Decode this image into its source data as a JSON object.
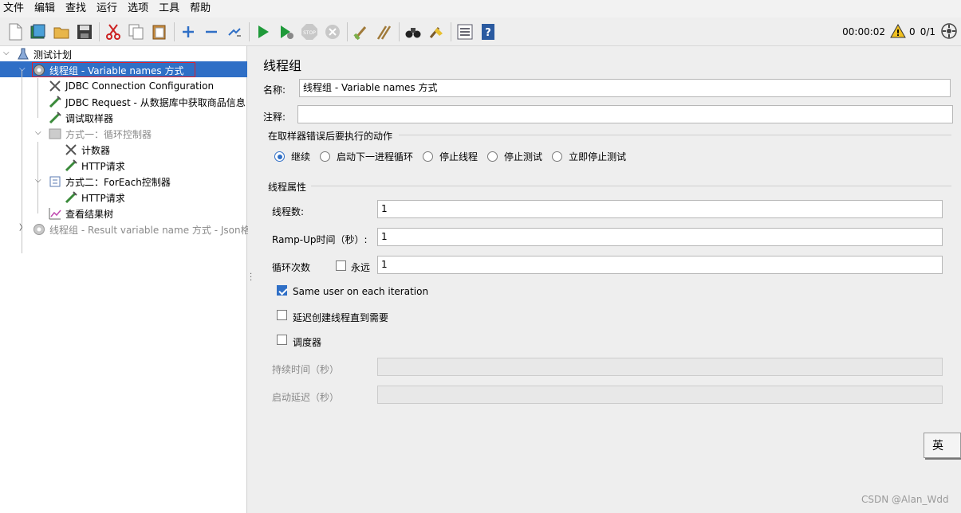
{
  "menu": [
    "文件",
    "编辑",
    "查找",
    "运行",
    "选项",
    "工具",
    "帮助"
  ],
  "toolbar": {
    "icons": [
      "new-icon",
      "templates-icon",
      "open-icon",
      "save-icon",
      "cut-icon",
      "copy-icon",
      "paste-icon",
      "expand-icon",
      "collapse-icon",
      "toggle-icon",
      "start-icon",
      "start-no-pause-icon",
      "stop-icon",
      "shutdown-icon",
      "clear-icon",
      "clear-all-icon",
      "search-icon",
      "reset-search-icon",
      "function-helper-icon",
      "help-icon"
    ],
    "timer": "00:00:02",
    "warnings": "0",
    "threads": "0/1"
  },
  "tree": {
    "items": [
      {
        "label": "测试计划",
        "icon": "test-plan-icon"
      },
      {
        "label": "线程组 - Variable names 方式",
        "icon": "thread-group-icon"
      },
      {
        "label": "JDBC Connection Configuration",
        "icon": "config-element-icon"
      },
      {
        "label": "JDBC Request - 从数据库中获取商品信息",
        "icon": "sampler-icon"
      },
      {
        "label": "调试取样器",
        "icon": "sampler-icon"
      },
      {
        "label": "方式一：循环控制器",
        "icon": "loop-controller-icon"
      },
      {
        "label": "计数器",
        "icon": "config-element-icon"
      },
      {
        "label": "HTTP请求",
        "icon": "sampler-icon"
      },
      {
        "label": "方式二：ForEach控制器",
        "icon": "foreach-controller-icon"
      },
      {
        "label": "HTTP请求",
        "icon": "sampler-icon"
      },
      {
        "label": "查看结果树",
        "icon": "listener-icon"
      },
      {
        "label": "线程组 - Result variable name 方式 - Json格式",
        "icon": "thread-group-icon"
      }
    ]
  },
  "panel": {
    "title": "线程组",
    "name_label": "名称:",
    "name_value": "线程组 - Variable names 方式",
    "comment_label": "注释:",
    "comment_value": "",
    "error_section": "在取样器错误后要执行的动作",
    "error_options": [
      "继续",
      "启动下一进程循环",
      "停止线程",
      "停止测试",
      "立即停止测试"
    ],
    "thread_section": "线程属性",
    "threads_label": "线程数:",
    "threads_value": "1",
    "rampup_label": "Ramp-Up时间（秒）:",
    "rampup_value": "1",
    "loop_label": "循环次数",
    "forever_label": "永远",
    "loop_value": "1",
    "same_user_label": "Same user on each iteration",
    "delay_label": "延迟创建线程直到需要",
    "scheduler_label": "调度器",
    "duration_label": "持续时间（秒）",
    "startup_delay_label": "启动延迟（秒）"
  },
  "ime": "英",
  "watermark": "CSDN @Alan_Wdd"
}
